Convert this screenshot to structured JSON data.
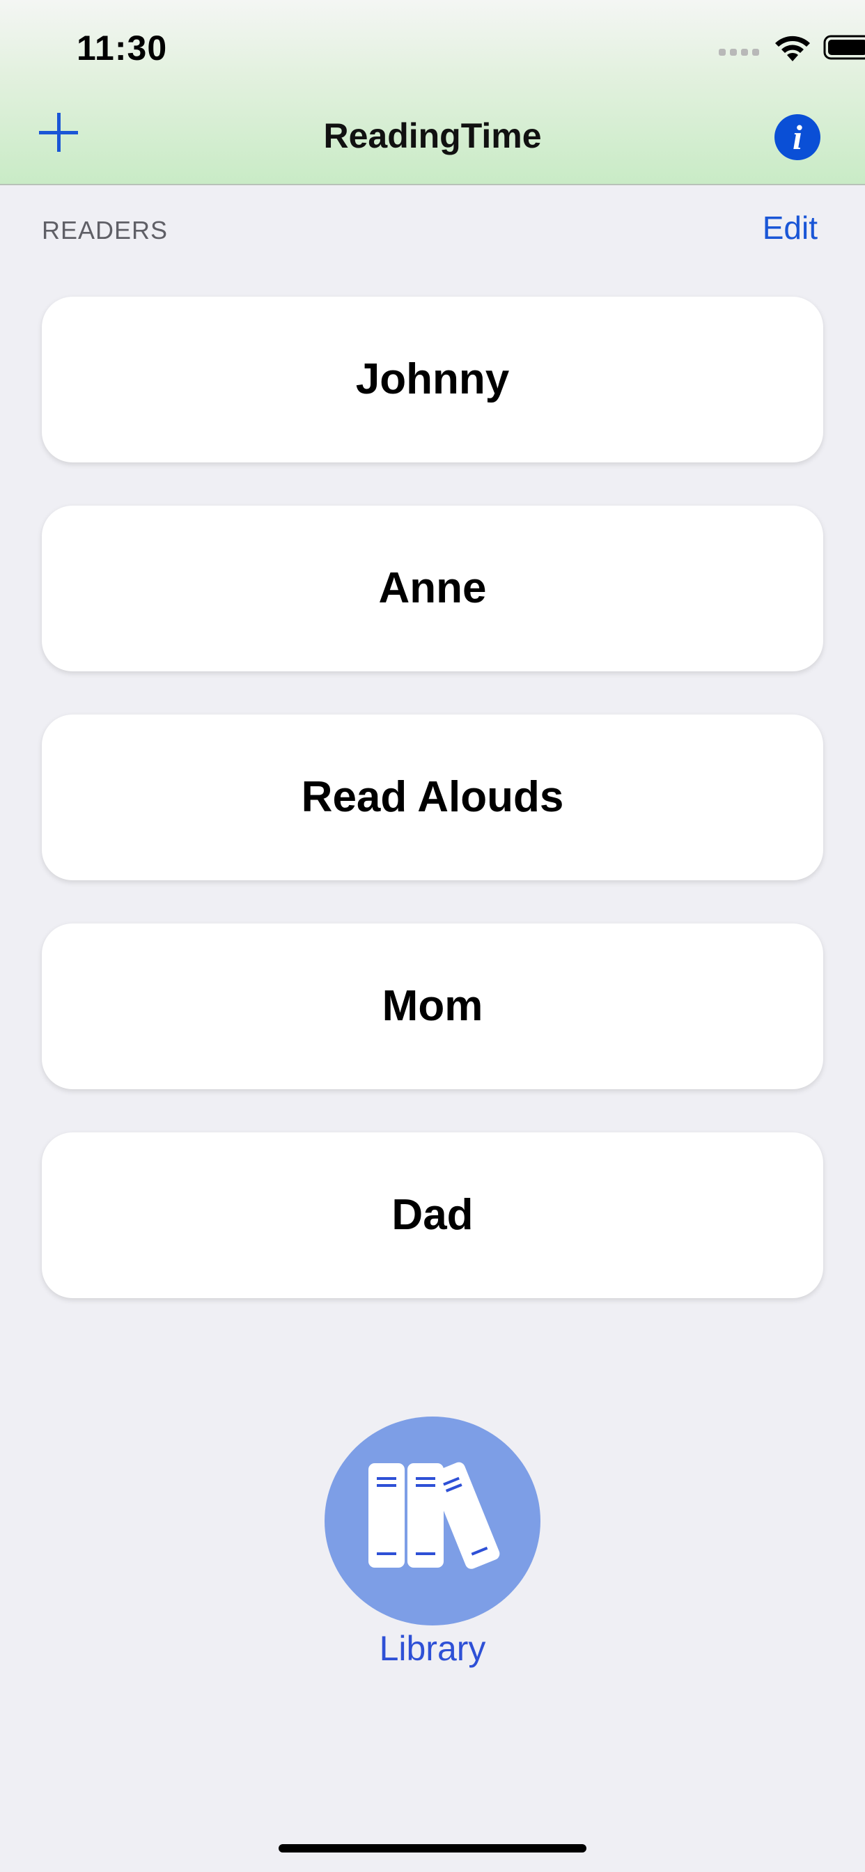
{
  "status_bar": {
    "time": "11:30"
  },
  "nav": {
    "title": "ReadingTime"
  },
  "section": {
    "label": "READERS",
    "edit_label": "Edit"
  },
  "readers": [
    {
      "name": "Johnny"
    },
    {
      "name": "Anne"
    },
    {
      "name": "Read Alouds"
    },
    {
      "name": "Mom"
    },
    {
      "name": "Dad"
    }
  ],
  "library": {
    "label": "Library",
    "icon": "books-icon"
  },
  "colors": {
    "accent": "#1a56d6",
    "nav_bar_tint": "#c9ebc6",
    "library_circle": "#7d9ee6",
    "background": "#efeff4"
  }
}
